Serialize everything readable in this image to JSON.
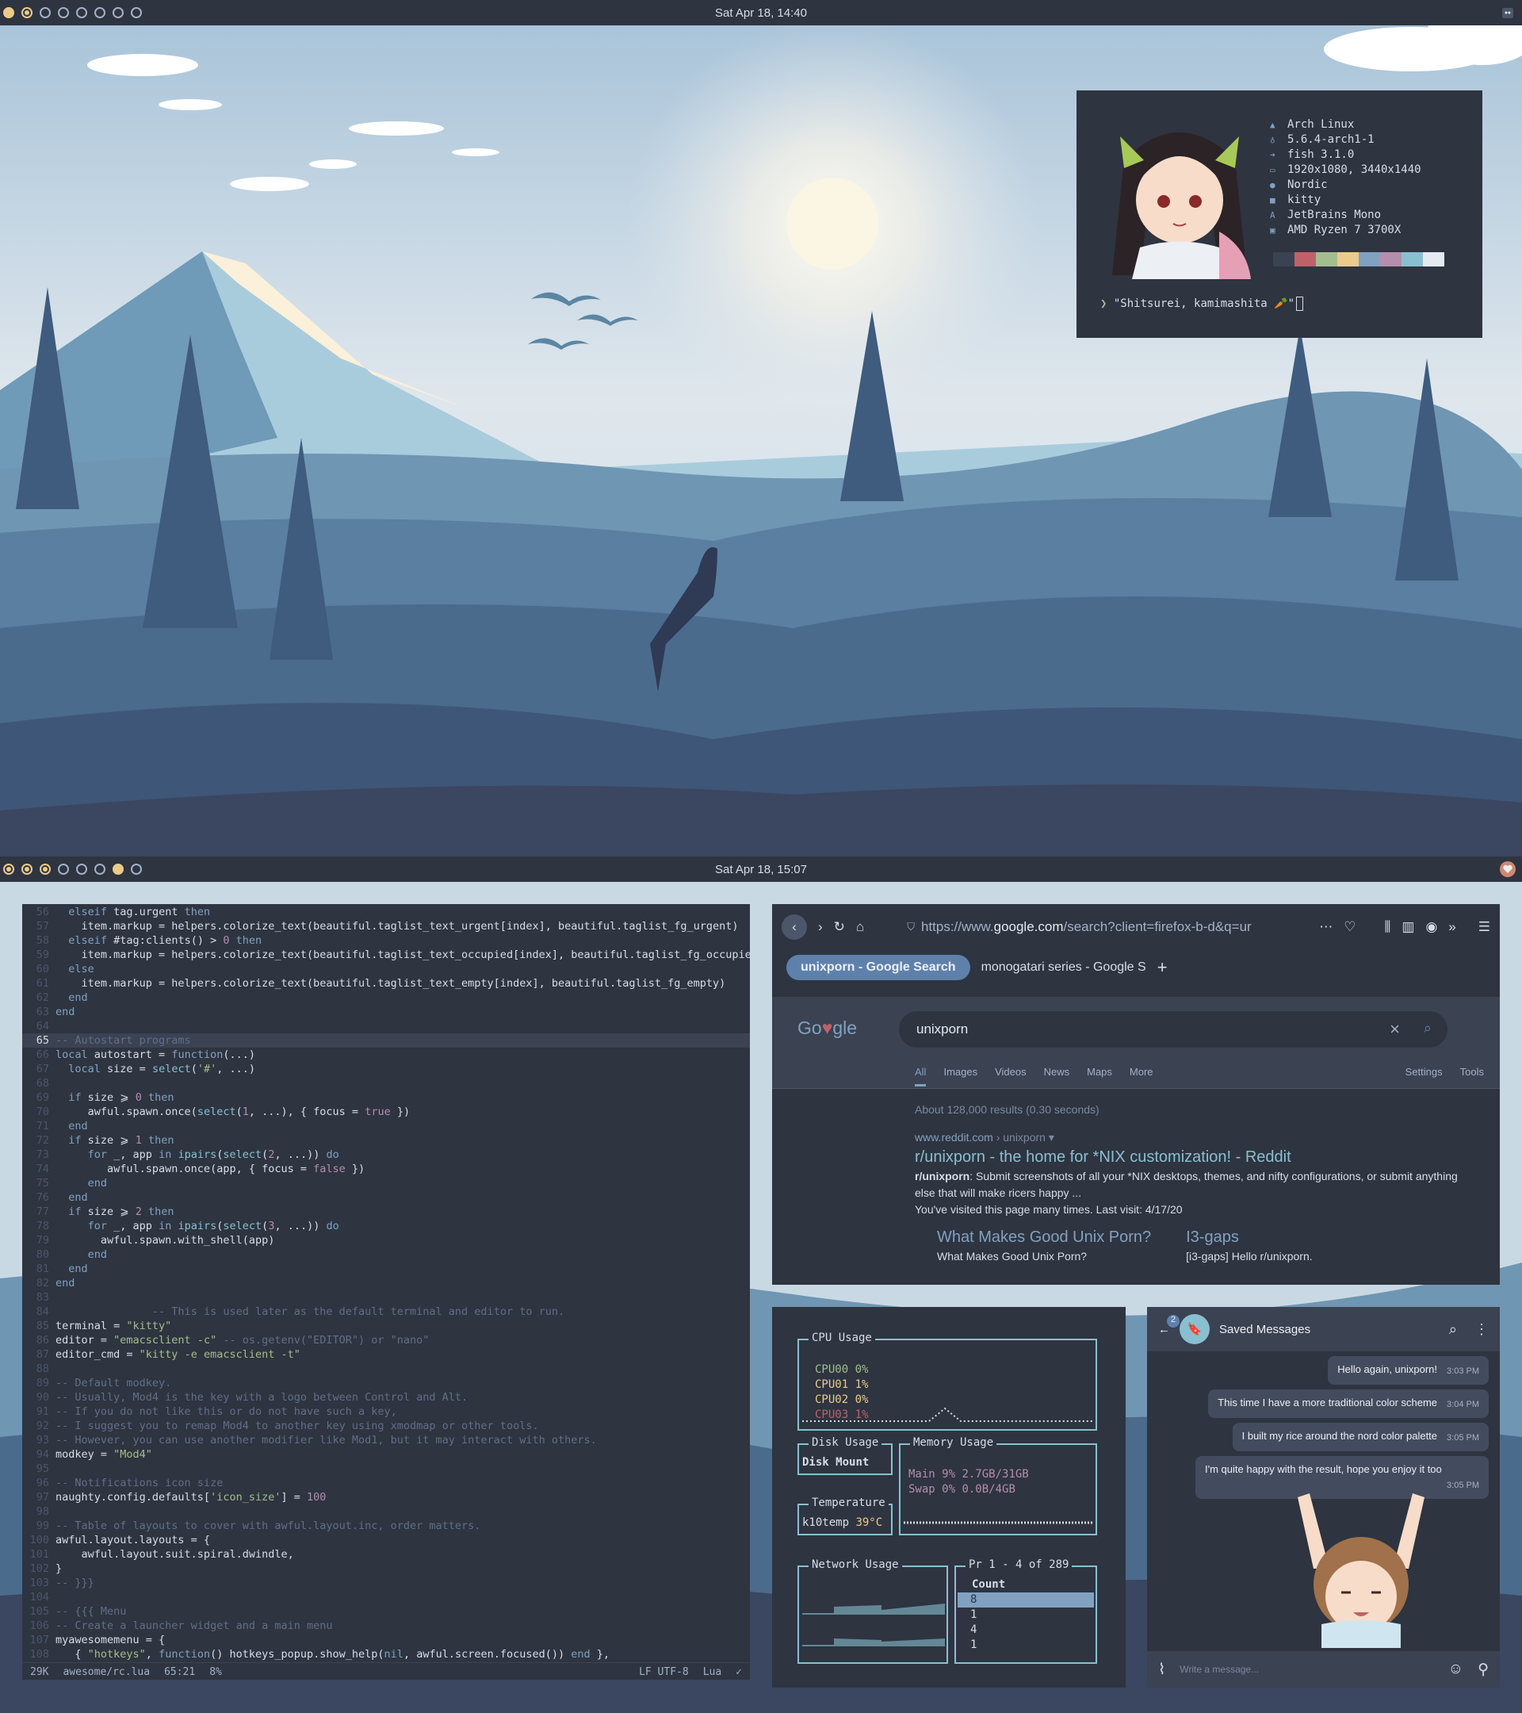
{
  "top_bar": {
    "clock": "Sat Apr 18, 14:40"
  },
  "bottom_bar": {
    "clock": "Sat Apr 18, 15:07"
  },
  "neofetch": {
    "info": [
      "Arch Linux",
      "5.6.4-arch1-1",
      "fish 3.1.0",
      "1920x1080, 3440x1440",
      "Nordic",
      "kitty",
      "JetBrains Mono",
      "AMD Ryzen 7 3700X"
    ],
    "icons": [
      "arch-icon",
      "kernel-icon",
      "shell-icon",
      "display-icon",
      "theme-icon",
      "terminal-icon",
      "font-icon",
      "cpu-icon"
    ],
    "palette": [
      "#3b4252",
      "#bf616a",
      "#a3be8c",
      "#ebcb8b",
      "#81a1c1",
      "#b48ead",
      "#88c0d0",
      "#e5e9f0"
    ],
    "prompt_symbol": "❯",
    "prompt_text": "\"Shitsurei, kamimashita 🥕\""
  },
  "editor": {
    "current_line": 65,
    "lines": [
      {
        "n": "56",
        "html": "  <span class='kw'>elseif</span> tag.urgent <span class='kw'>then</span>"
      },
      {
        "n": "57",
        "html": "    item.markup = helpers.colorize_text(beautiful.taglist_text_urgent[index], beautiful.taglist_fg_urgent)"
      },
      {
        "n": "58",
        "html": "  <span class='kw'>elseif</span> #tag:clients() &gt; <span class='nu'>0</span> <span class='kw'>then</span>"
      },
      {
        "n": "59",
        "html": "    item.markup = helpers.colorize_text(beautiful.taglist_text_occupied[index], beautiful.taglist_fg_occupie"
      },
      {
        "n": "60",
        "html": "  <span class='kw'>else</span>"
      },
      {
        "n": "61",
        "html": "    item.markup = helpers.colorize_text(beautiful.taglist_text_empty[index], beautiful.taglist_fg_empty)"
      },
      {
        "n": "62",
        "html": "  <span class='kw'>end</span>"
      },
      {
        "n": "63",
        "html": "<span class='kw'>end</span>"
      },
      {
        "n": "64",
        "html": ""
      },
      {
        "n": "65",
        "html": "<span class='cm'>-- Autostart programs</span>"
      },
      {
        "n": "66",
        "html": "<span class='kw'>local</span> autostart = <span class='kw'>function</span>(...)"
      },
      {
        "n": "67",
        "html": "  <span class='kw'>local</span> size = <span class='fn'>select</span>(<span class='st'>'#'</span>, ...)"
      },
      {
        "n": "68",
        "html": ""
      },
      {
        "n": "69",
        "html": "  <span class='kw'>if</span> size ⩾ <span class='nu'>0</span> <span class='kw'>then</span>"
      },
      {
        "n": "70",
        "html": "     awful.spawn.once(<span class='fn'>select</span>(<span class='nu'>1</span>, ...), { focus = <span class='nu'>true</span> })"
      },
      {
        "n": "71",
        "html": "  <span class='kw'>end</span>"
      },
      {
        "n": "72",
        "html": "  <span class='kw'>if</span> size ⩾ <span class='nu'>1</span> <span class='kw'>then</span>"
      },
      {
        "n": "73",
        "html": "     <span class='kw'>for</span> _, app <span class='kw'>in</span> <span class='fn'>ipairs</span>(<span class='fn'>select</span>(<span class='nu'>2</span>, ...)) <span class='kw'>do</span>"
      },
      {
        "n": "74",
        "html": "        awful.spawn.once(app, { focus = <span class='nu'>false</span> })"
      },
      {
        "n": "75",
        "html": "     <span class='kw'>end</span>"
      },
      {
        "n": "76",
        "html": "  <span class='kw'>end</span>"
      },
      {
        "n": "77",
        "html": "  <span class='kw'>if</span> size ⩾ <span class='nu'>2</span> <span class='kw'>then</span>"
      },
      {
        "n": "78",
        "html": "     <span class='kw'>for</span> _, app <span class='kw'>in</span> <span class='fn'>ipairs</span>(<span class='fn'>select</span>(<span class='nu'>3</span>, ...)) <span class='kw'>do</span>"
      },
      {
        "n": "79",
        "html": "       awful.spawn.with_shell(app)"
      },
      {
        "n": "80",
        "html": "     <span class='kw'>end</span>"
      },
      {
        "n": "81",
        "html": "  <span class='kw'>end</span>"
      },
      {
        "n": "82",
        "html": "<span class='kw'>end</span>"
      },
      {
        "n": "83",
        "html": ""
      },
      {
        "n": "84",
        "html": "               <span class='cm'>-- This is used later as the default terminal and editor to run.</span>"
      },
      {
        "n": "85",
        "html": "terminal = <span class='st'>\"kitty\"</span>"
      },
      {
        "n": "86",
        "html": "editor = <span class='st'>\"emacsclient -c\"</span> <span class='cm'>-- os.getenv(\"EDITOR\") or \"nano\"</span>"
      },
      {
        "n": "87",
        "html": "editor_cmd = <span class='st'>\"kitty -e emacsclient -t\"</span>"
      },
      {
        "n": "88",
        "html": ""
      },
      {
        "n": "89",
        "html": "<span class='cm'>-- Default modkey.</span>"
      },
      {
        "n": "90",
        "html": "<span class='cm'>-- Usually, Mod4 is the key with a logo between Control and Alt.</span>"
      },
      {
        "n": "91",
        "html": "<span class='cm'>-- If you do not like this or do not have such a key,</span>"
      },
      {
        "n": "92",
        "html": "<span class='cm'>-- I suggest you to remap Mod4 to another key using xmodmap or other tools.</span>"
      },
      {
        "n": "93",
        "html": "<span class='cm'>-- However, you can use another modifier like Mod1, but it may interact with others.</span>"
      },
      {
        "n": "94",
        "html": "modkey = <span class='st'>\"Mod4\"</span>"
      },
      {
        "n": "95",
        "html": ""
      },
      {
        "n": "96",
        "html": "<span class='cm'>-- Notifications icon size</span>"
      },
      {
        "n": "97",
        "html": "naughty.config.defaults[<span class='st'>'icon_size'</span>] = <span class='nu'>100</span>"
      },
      {
        "n": "98",
        "html": ""
      },
      {
        "n": "99",
        "html": "<span class='cm'>-- Table of layouts to cover with awful.layout.inc, order matters.</span>"
      },
      {
        "n": "100",
        "html": "awful.layout.layouts = {"
      },
      {
        "n": "101",
        "html": "    awful.layout.suit.spiral.dwindle,"
      },
      {
        "n": "102",
        "html": "}"
      },
      {
        "n": "103",
        "html": "<span class='cm'>-- }}}</span>"
      },
      {
        "n": "104",
        "html": ""
      },
      {
        "n": "105",
        "html": "<span class='cm'>-- {{{ Menu</span>"
      },
      {
        "n": "106",
        "html": "<span class='cm'>-- Create a launcher widget and a main menu</span>"
      },
      {
        "n": "107",
        "html": "myawesomemenu = {"
      },
      {
        "n": "108",
        "html": "   { <span class='st'>\"hotkeys\"</span>, <span class='kw'>function</span>() hotkeys_popup.show_help(<span class='kw'>nil</span>, awful.screen.focused()) <span class='kw'>end</span> },"
      }
    ],
    "status": {
      "size": "29K",
      "file": "awesome/rc.lua",
      "pos": "65:21",
      "pct": "8%",
      "enc": "LF UTF-8",
      "mode": "Lua",
      "check": "✓"
    }
  },
  "browser": {
    "url_pre": "https://www.",
    "url_domain": "google.com",
    "url_rest": "/search?client=firefox-b-d&q=ur",
    "tabs": [
      "unixporn - Google Search",
      "monogatari series - Google S"
    ],
    "new_tab": "+",
    "google": {
      "query": "unixporn",
      "tabs": [
        "All",
        "Images",
        "Videos",
        "News",
        "Maps",
        "More",
        "Settings",
        "Tools"
      ],
      "count": "About 128,000 results (0.30 seconds)",
      "cite_domain": "www.reddit.com",
      "cite_path": " › unixporn",
      "title": "r/unixporn - the home for *NIX customization! - Reddit",
      "snippet_bold": "r/unixporn",
      "snippet": ": Submit screenshots of all your *NIX desktops, themes, and nifty configurations, or submit anything else that will make ricers happy ...",
      "visited": "You've visited this page many times. Last visit: 4/17/20",
      "sitelinks": [
        {
          "title": "What Makes Good Unix Porn?",
          "desc": "What Makes Good Unix Porn?"
        },
        {
          "title": "I3-gaps",
          "desc": "[i3-gaps] Hello r/unixporn."
        }
      ]
    }
  },
  "gotop": {
    "cpu_title": "CPU Usage",
    "cpus": [
      {
        "label": "CPU00",
        "val": "0%"
      },
      {
        "label": "CPU01",
        "val": "1%"
      },
      {
        "label": "CPU02",
        "val": "0%"
      },
      {
        "label": "CPU03",
        "val": "1%"
      }
    ],
    "disk_title": "Disk Usage",
    "disk_cols": [
      "Disk",
      "Mount"
    ],
    "mem_title": "Memory Usage",
    "mem": [
      {
        "label": "Main",
        "pct": "9%",
        "val": "2.7GB/31GB"
      },
      {
        "label": "Swap",
        "pct": "0%",
        "val": "0.0B/4GB"
      }
    ],
    "temp_title": "Temperature",
    "temp_label": "k10temp",
    "temp_val": "39°C",
    "net_title": "Network Usage",
    "proc_title": "Pr 1 - 4 of 289",
    "proc_col": "Count",
    "proc_counts": [
      "8",
      "1",
      "4",
      "1"
    ]
  },
  "telegram": {
    "badge": "2",
    "title": "Saved Messages",
    "messages": [
      {
        "text": "Hello again, unixporn!",
        "time": "3:03 PM"
      },
      {
        "text": "This time I have a more traditional color scheme",
        "time": "3:04 PM"
      },
      {
        "text": "I built my rice around the nord color palette",
        "time": "3:05 PM"
      },
      {
        "text": "I'm quite happy with the result, hope you enjoy it too",
        "time": "3:05 PM"
      }
    ],
    "placeholder": "Write a message..."
  }
}
